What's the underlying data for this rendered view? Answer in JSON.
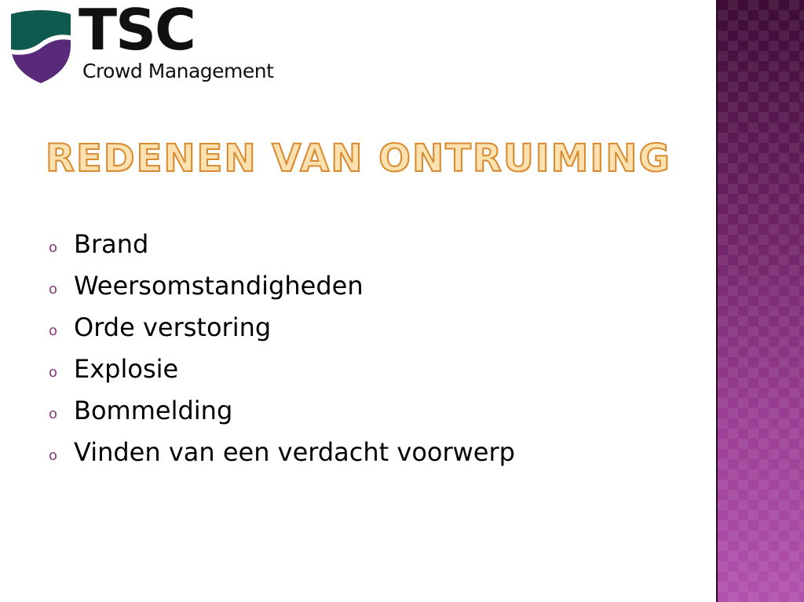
{
  "logo": {
    "name": "TSC",
    "subtitle": "Crowd Management",
    "shield_colors": {
      "top": "#0f5a4e",
      "bottom": "#5a2a7a"
    }
  },
  "slide": {
    "title": "REDENEN VAN ONTRUIMING",
    "bullet_marker": "o",
    "bullets": [
      "Brand",
      "Weersomstandigheden",
      "Orde verstoring",
      "Explosie",
      "Bommelding",
      "Vinden van een verdacht voorwerp"
    ]
  },
  "colors": {
    "title_fill": "#fbe1b0",
    "title_outline": "#d98a2e",
    "accent_band": "#7b2a6e"
  }
}
